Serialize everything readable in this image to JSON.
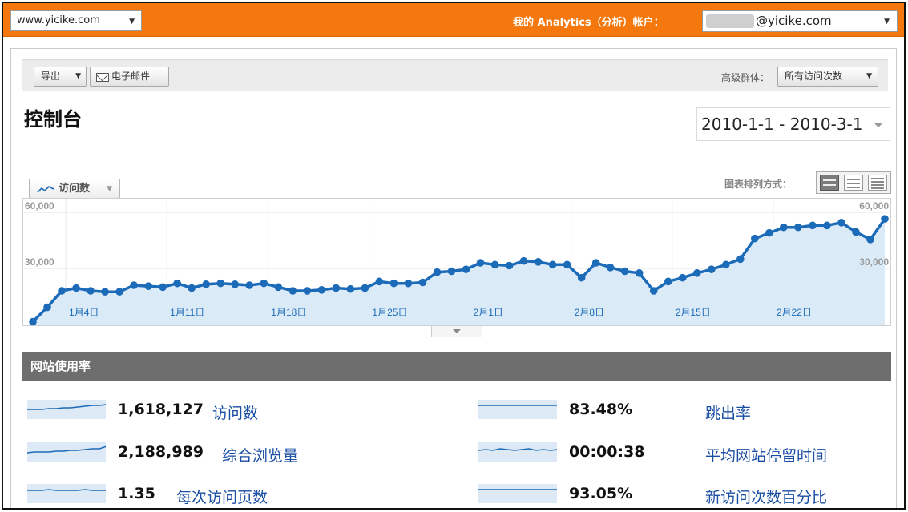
{
  "topbar": {
    "site": "www.yicike.com",
    "account_label": "我的 Analytics（分析）帐户：",
    "account_domain": "@yicike.com"
  },
  "toolbar": {
    "export_label": "导出",
    "email_label": "电子邮件",
    "segment_label": "高级群体：",
    "segment_value": "所有访问次数"
  },
  "page": {
    "title": "控制台",
    "date_range": "2010-1-1 - 2010-3-1"
  },
  "graph": {
    "metric_tab": "访问数",
    "layout_label": "图表排列方式："
  },
  "chart_data": {
    "type": "area",
    "title": "",
    "y_ticks_left": [
      "60,000",
      "30,000"
    ],
    "y_ticks_right": [
      "60,000",
      "30,000"
    ],
    "ylim": [
      0,
      60000
    ],
    "x_tick_labels": [
      "1月4日",
      "1月11日",
      "1月18日",
      "1月25日",
      "2月1日",
      "2月8日",
      "2月15日",
      "2月22日"
    ],
    "x_tick_day_index": [
      3,
      10,
      17,
      24,
      31,
      38,
      45,
      52
    ],
    "x_start_date": "2010-1-1",
    "series": [
      {
        "name": "访问数",
        "color": "#1c6bb8",
        "fill": "#dbeaf7",
        "values": [
          1500,
          9200,
          18000,
          19500,
          18000,
          17500,
          17500,
          21000,
          20500,
          20000,
          22000,
          19500,
          21500,
          22000,
          21500,
          21000,
          22000,
          20000,
          18000,
          18000,
          18500,
          19500,
          19000,
          19500,
          23000,
          22000,
          22000,
          22500,
          28000,
          28500,
          29500,
          33000,
          32000,
          31500,
          34000,
          33500,
          32000,
          32000,
          25000,
          33000,
          30500,
          28500,
          27500,
          18000,
          23000,
          25000,
          27500,
          29500,
          32000,
          35000,
          46000,
          49000,
          52000,
          52000,
          53000,
          53000,
          54500,
          49500,
          45500,
          56500
        ]
      }
    ],
    "grid": true
  },
  "usage": {
    "header": "网站使用率",
    "stats": [
      {
        "value": "1,618,127",
        "label": "访问数"
      },
      {
        "value": "2,188,989",
        "label": "综合浏览量"
      },
      {
        "value": "1.35",
        "label": "每次访问页数"
      },
      {
        "value": "83.48%",
        "label": "跳出率"
      },
      {
        "value": "00:00:38",
        "label": "平均网站停留时间"
      },
      {
        "value": "93.05%",
        "label": "新访问次数百分比"
      }
    ]
  },
  "colors": {
    "topbar": "#f5780f",
    "link": "#1a4ea3",
    "series": "#1c6bb8",
    "header": "#6e6e6e"
  }
}
